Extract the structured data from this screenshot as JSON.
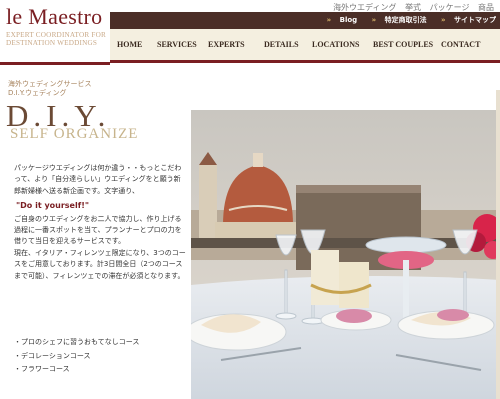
{
  "logo": {
    "title": "le Maestro",
    "subtitle": "EXPERT COORDINATOR FOR DESTINATION WEDDINGS"
  },
  "top_links": [
    "海外ウエディング",
    "挙式",
    "パッケージ",
    "商品"
  ],
  "util_links": [
    "Blog",
    "特定商取引法",
    "サイトマップ"
  ],
  "nav": [
    "HOME",
    "SERVICES",
    "EXPERTS",
    "DETAILS",
    "LOCATIONS",
    "BEST COUPLES",
    "CONTACT"
  ],
  "category": {
    "line1": "海外ウェディングサービス",
    "line2": "D.I.Y.ウェディング"
  },
  "heading": {
    "title": "D.I.Y.",
    "subtitle": "SELF ORGANIZE"
  },
  "intro": {
    "p1": "パッケージウエディングは何か違う・・もっとこだわって、より「自分達らしい」ウエディングをと願う新郎新婦様へ送る新企画です。文字通り、",
    "quote": "\"Do it yourself!\"",
    "p2": "ご自身のウエディングをお二人で協力し、作り上げる過程に一番スポットを当て、プランナーとプロの力を借りて当日を迎えるサービスです。",
    "p3": "現在、イタリア・フィレンツェ限定になり、3つのコースをご用意しております。計3日間全日（2つのコースまで可能）、フィレンツェでの滞在が必須となります。"
  },
  "courses": [
    "・プロのシェフに習うおもてなしコース",
    "・デコレーションコース",
    "・フラワーコース"
  ],
  "colors": {
    "brand": "#7a1e22",
    "dark_bar": "#4b2e27",
    "nav_bg": "#f4efe0",
    "gold": "#c7b48c",
    "diy_brown": "#6b4a35"
  },
  "image": {
    "description": "outdoor-table-with-wine-glasses-candles-and-florence-duomo"
  }
}
